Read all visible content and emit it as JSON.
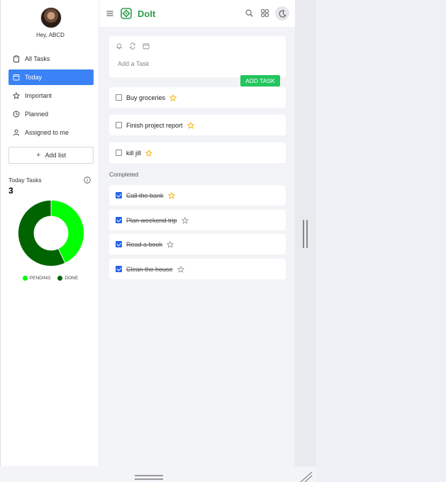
{
  "user": {
    "greeting": "Hey, ABCD"
  },
  "nav": {
    "items": [
      {
        "label": "All Tasks",
        "icon": "clipboard-icon",
        "active": false
      },
      {
        "label": "Today",
        "icon": "calendar-icon",
        "active": true
      },
      {
        "label": "Important",
        "icon": "star-icon",
        "active": false
      },
      {
        "label": "Planned",
        "icon": "clock-icon",
        "active": false
      },
      {
        "label": "Assigned to me",
        "icon": "user-icon",
        "active": false
      }
    ],
    "add_list_label": "Add list"
  },
  "stats": {
    "title": "Today Tasks",
    "count": "3",
    "legend": {
      "pending": "PENDING",
      "done": "DONE"
    },
    "pending_fraction": 0.43,
    "done_fraction": 0.57
  },
  "colors": {
    "pending": "#00ff00",
    "done": "#006400",
    "accent": "#3b82f6",
    "brand": "#2e9e4f",
    "add_button": "#22c55e",
    "star": "#f5b301"
  },
  "header": {
    "title": "DoIt"
  },
  "composer": {
    "placeholder": "Add a Task",
    "button_label": "ADD TASK"
  },
  "tasks": [
    {
      "text": "Buy groceries",
      "starred": true
    },
    {
      "text": "Finish project report",
      "starred": true
    },
    {
      "text": "kill jill",
      "starred": true
    }
  ],
  "completed": {
    "label": "Completed",
    "tasks": [
      {
        "text": "Call the bank",
        "starred": true
      },
      {
        "text": "Plan weekend trip",
        "starred": false
      },
      {
        "text": "Read a book",
        "starred": false
      },
      {
        "text": "Clean the house",
        "starred": false
      }
    ]
  }
}
